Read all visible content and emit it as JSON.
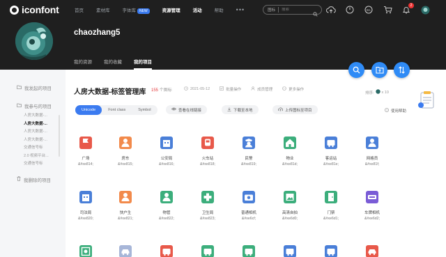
{
  "header": {
    "logo_text": "iconfont",
    "nav": [
      {
        "label": "首页",
        "active": false
      },
      {
        "label": "素材库",
        "active": false
      },
      {
        "label": "字体库",
        "badge": "NEW",
        "active": false
      },
      {
        "label": "资源管理",
        "active": true
      },
      {
        "label": "活动",
        "active": true
      },
      {
        "label": "帮助",
        "active": false
      }
    ],
    "more": "•••",
    "search": {
      "scope": "图标",
      "placeholder": "搜索"
    },
    "notification_count": "2"
  },
  "profile": {
    "username": "chaozhang5",
    "tabs": [
      {
        "label": "我的资源",
        "active": false
      },
      {
        "label": "我的收藏",
        "active": false
      },
      {
        "label": "我的项目",
        "active": true
      }
    ]
  },
  "sidebar": {
    "group_created": "我发起的项目",
    "group_joined": "我参与的项目",
    "projects": [
      {
        "label": "人房大数据-...",
        "active": false
      },
      {
        "label": "人房大数据-...",
        "active": true
      },
      {
        "label": "人房大数据-...",
        "active": false
      },
      {
        "label": "人房大数据-...",
        "active": false
      },
      {
        "label": "交通信号标",
        "active": false
      },
      {
        "label": "2.0 视频平台...",
        "active": false
      },
      {
        "label": "交通信号标",
        "active": false
      }
    ],
    "group_deleted": "我删除的项目"
  },
  "project": {
    "title": "人房大数据-标签管理库",
    "icon_count": "155",
    "icon_count_unit": "个图标",
    "date": "2021-05-12",
    "batch_action": "批量操作",
    "members": "成员管理",
    "more_action": "更多操作",
    "sort": "排序: ",
    "sort_count": "x 10",
    "help": "使用帮助"
  },
  "tabs": [
    {
      "label": "Unicode",
      "active": true
    },
    {
      "label": "Font class",
      "active": false
    },
    {
      "label": "Symbol",
      "active": false
    }
  ],
  "actions": {
    "view_online": "查看在线链接",
    "download": "下载至本地",
    "upload": "上传图标至项目"
  },
  "accent_color": "#3b7bf0",
  "icons": [
    {
      "name": "广场",
      "code": "&#xe814;",
      "color": "#e8594a",
      "icon": "flag-icon"
    },
    {
      "name": "房东",
      "code": "&#xe815;",
      "color": "#f28a4b",
      "icon": "person-icon"
    },
    {
      "name": "公安局",
      "code": "&#xe816;",
      "color": "#4a7fd8",
      "icon": "building-icon"
    },
    {
      "name": "火车站",
      "code": "&#xe818;",
      "color": "#e8594a",
      "icon": "train-icon"
    },
    {
      "name": "民警",
      "code": "&#xe819;",
      "color": "#4a7fd8",
      "icon": "police-icon"
    },
    {
      "name": "物业",
      "code": "&#xe81d;",
      "color": "#3cae7c",
      "icon": "house-icon"
    },
    {
      "name": "客运站",
      "code": "&#xe81e;",
      "color": "#4a7fd8",
      "icon": "bus-icon"
    },
    {
      "name": "网格员",
      "code": "&#xe81f;",
      "color": "#4a7fd8",
      "icon": "person-icon"
    },
    {
      "name": "司法局",
      "code": "&#xe820;",
      "color": "#4a7fd8",
      "icon": "building-icon"
    },
    {
      "name": "快户生",
      "code": "&#xe821;",
      "color": "#f28a4b",
      "icon": "person-icon"
    },
    {
      "name": "物管",
      "code": "&#xe822;",
      "color": "#3cae7c",
      "icon": "person-icon"
    },
    {
      "name": "卫生局",
      "code": "&#xe823;",
      "color": "#3cae7c",
      "icon": "cross-icon"
    },
    {
      "name": "普通相机",
      "code": "&#xe6cf;",
      "color": "#4a7fd8",
      "icon": "camera-icon"
    },
    {
      "name": "高清自拍",
      "code": "&#xe6d0;",
      "color": "#3cae7c",
      "icon": "image-icon"
    },
    {
      "name": "门禁",
      "code": "&#xe6d1;",
      "color": "#3cae7c",
      "icon": "door-icon"
    },
    {
      "name": "车牌相机",
      "code": "&#xe6d2;",
      "color": "#7a5cd6",
      "icon": "plate-icon"
    },
    {
      "name": "",
      "code": "",
      "color": "#3cae7c",
      "icon": "face-icon"
    },
    {
      "name": "",
      "code": "",
      "color": "#a7b6d8",
      "icon": "car-icon"
    },
    {
      "name": "",
      "code": "",
      "color": "#e8594a",
      "icon": "bus-icon"
    },
    {
      "name": "",
      "code": "",
      "color": "#3cae7c",
      "icon": "bus-icon"
    },
    {
      "name": "",
      "code": "",
      "color": "#3cae7c",
      "icon": "bus-icon"
    },
    {
      "name": "",
      "code": "",
      "color": "#4a7fd8",
      "icon": "bus-icon"
    },
    {
      "name": "",
      "code": "",
      "color": "#4a7fd8",
      "icon": "bus-icon"
    },
    {
      "name": "",
      "code": "",
      "color": "#e8594a",
      "icon": "car-icon"
    }
  ]
}
